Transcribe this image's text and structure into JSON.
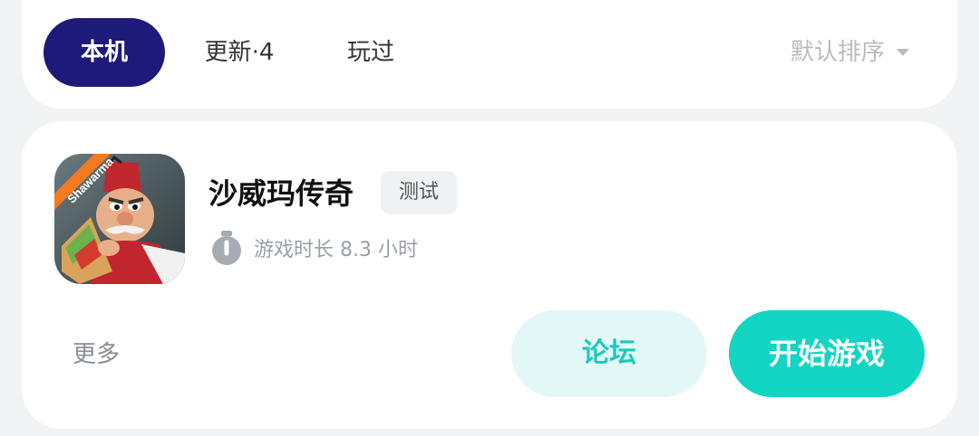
{
  "tabs": {
    "local": "本机",
    "updates": "更新·4",
    "played": "玩过"
  },
  "sort": {
    "label": "默认排序",
    "icon": "caret-down-icon"
  },
  "game": {
    "title": "沙威玛传奇",
    "badge": "测试",
    "playtime": "游戏时长 8.3 小时",
    "icon_label": "Shawarma",
    "timer_icon": "stopwatch-icon"
  },
  "actions": {
    "more": "更多",
    "forum": "论坛",
    "play": "开始游戏"
  },
  "colors": {
    "active_tab": "#1e1a7a",
    "primary": "#12d5c3",
    "secondary_bg": "#e3f8f6",
    "secondary_text": "#1ec9bd"
  }
}
